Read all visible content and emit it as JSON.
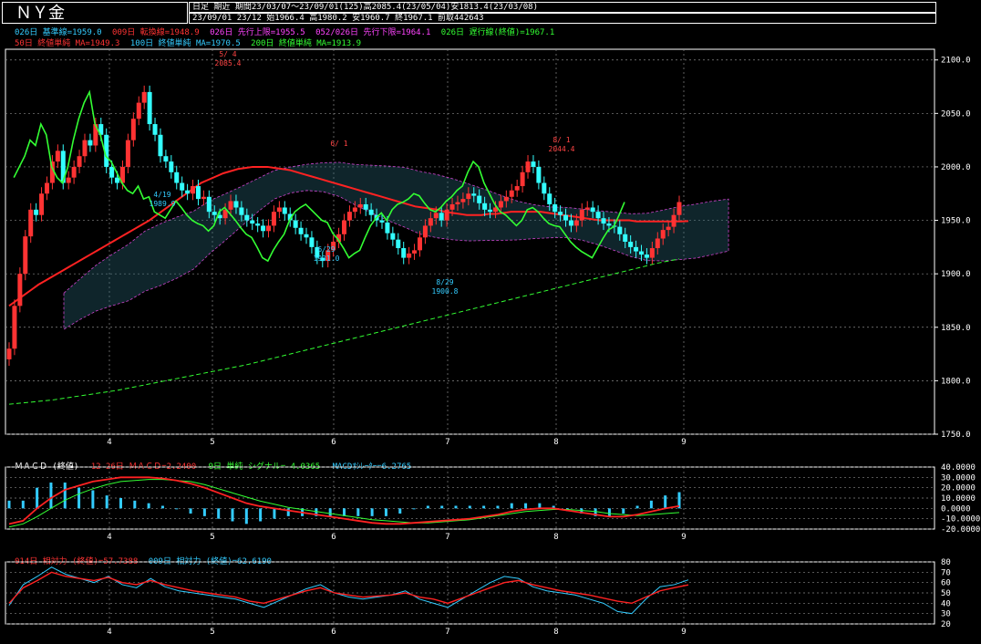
{
  "header": {
    "title": "ＮＹ金",
    "line1": "日足 期近 期間23/03/07～23/09/01(125)高2085.4(23/05/04)安1813.4(23/03/08)",
    "line2": "23/09/01 23/12 始1966.4 高1980.2 安1960.7 終1967.1 前取442643"
  },
  "legend": {
    "row1": [
      {
        "text": "026日 基準線=1959.0",
        "color": "#33ccff"
      },
      {
        "text": "009日 転換線=1948.9",
        "color": "#ff3333"
      },
      {
        "text": "026日 先行上限=1955.5",
        "color": "#ff44ff"
      },
      {
        "text": "052/026日 先行下限=1964.1",
        "color": "#ff44ff"
      },
      {
        "text": "026日 遅行線(終値)=1967.1",
        "color": "#33ff33"
      }
    ],
    "row2": [
      {
        "text": "50日 終値単純 MA=1949.3",
        "color": "#ff3333"
      },
      {
        "text": "100日 終値単純 MA=1970.5",
        "color": "#33ccff"
      },
      {
        "text": "200日 終値単純 MA=1913.9",
        "color": "#33ff33"
      }
    ]
  },
  "macd_legend": [
    {
      "text": "ＭＡＣＤ (終値)",
      "color": "#ffffff"
    },
    {
      "text": "12-26日 ＭＡＣＤ=2.2400",
      "color": "#ff3333"
    },
    {
      "text": "9日 単純 シグナル=-4.0365",
      "color": "#33ff33"
    },
    {
      "text": "MACDｵｼﾚｰﾀｰ=6.2765",
      "color": "#33ccff"
    }
  ],
  "rsi_legend": [
    {
      "text": "014日 相対力 (終値)=57.7388",
      "color": "#ff3333"
    },
    {
      "text": "009日 相対力 (終値)=62.6190",
      "color": "#33ccff"
    }
  ],
  "chart_data": [
    {
      "type": "candlestick",
      "title": "ＮＹ金",
      "x_ticks": [
        "4",
        "5",
        "6",
        "7",
        "8",
        "9"
      ],
      "y_ticks": [
        "2100.0",
        "2050.0",
        "2000.0",
        "1950.0",
        "1900.0",
        "1850.0",
        "1800.0",
        "1750.0"
      ],
      "ylim": [
        1750,
        2110
      ],
      "annotations": [
        {
          "date": "5/ 4",
          "value": "2085.4"
        },
        {
          "date": "4/19",
          "value": "1989.9"
        },
        {
          "date": "6/ 1",
          "value": ""
        },
        {
          "date": "6/29",
          "value": "1931.0"
        },
        {
          "date": "8/ 1",
          "value": "2044.4"
        },
        {
          "date": "8/29",
          "value": "1900.8"
        }
      ],
      "close": [
        1830,
        1870,
        1900,
        1935,
        1960,
        1955,
        1975,
        1985,
        2005,
        2015,
        1985,
        1990,
        2000,
        2010,
        2025,
        2020,
        2040,
        2030,
        2000,
        1990,
        1985,
        2000,
        2025,
        2045,
        2060,
        2070,
        2040,
        2030,
        2010,
        2005,
        1995,
        1985,
        1978,
        1975,
        1982,
        1970,
        1972,
        1958,
        1955,
        1952,
        1960,
        1968,
        1962,
        1955,
        1950,
        1947,
        1945,
        1940,
        1945,
        1958,
        1962,
        1956,
        1950,
        1943,
        1937,
        1934,
        1925,
        1915,
        1912,
        1922,
        1930,
        1937,
        1950,
        1958,
        1962,
        1965,
        1960,
        1955,
        1950,
        1948,
        1938,
        1932,
        1924,
        1915,
        1919,
        1922,
        1934,
        1945,
        1952,
        1957,
        1950,
        1960,
        1965,
        1967,
        1970,
        1975,
        1973,
        1966,
        1960,
        1958,
        1962,
        1968,
        1972,
        1978,
        1982,
        1995,
        2005,
        2000,
        1985,
        1975,
        1965,
        1958,
        1955,
        1950,
        1945,
        1950,
        1960,
        1962,
        1958,
        1952,
        1947,
        1945,
        1944,
        1937,
        1930,
        1925,
        1921,
        1918,
        1915,
        1924,
        1933,
        1941,
        1944,
        1955,
        1967.1
      ],
      "ma50": [
        1870,
        1875,
        1880,
        1885,
        1890,
        1894,
        1898,
        1902,
        1906,
        1910,
        1914,
        1918,
        1922,
        1926,
        1930,
        1934,
        1938,
        1942,
        1946,
        1950,
        1955,
        1960,
        1965,
        1970,
        1975,
        1980,
        1985,
        1988,
        1991,
        1994,
        1996,
        1998,
        1999,
        2000,
        2000,
        2000,
        1999,
        1998,
        1997,
        1995,
        1993,
        1991,
        1989,
        1987,
        1985,
        1983,
        1981,
        1979,
        1977,
        1975,
        1973,
        1971,
        1969,
        1967,
        1965,
        1963,
        1962,
        1961,
        1960,
        1958,
        1957,
        1956,
        1955,
        1955,
        1955,
        1956,
        1956,
        1957,
        1958,
        1958,
        1958,
        1958,
        1958,
        1957,
        1956,
        1955,
        1954,
        1953,
        1952,
        1951,
        1950,
        1950,
        1950,
        1950,
        1950,
        1949,
        1949,
        1949,
        1949,
        1949,
        1949,
        1949,
        1949.3
      ],
      "ma200": [
        1778,
        1780,
        1782,
        1785,
        1788,
        1791,
        1795,
        1799,
        1803,
        1807,
        1811,
        1815,
        1820,
        1825,
        1830,
        1835,
        1840,
        1845,
        1850,
        1855,
        1860,
        1865,
        1870,
        1875,
        1880,
        1885,
        1890,
        1895,
        1900,
        1905,
        1910,
        1913.9
      ]
    },
    {
      "type": "line",
      "title": "ＭＡＣＤ (終値)",
      "y_ticks": [
        "40.0000",
        "30.0000",
        "20.0000",
        "10.0000",
        "0.0000",
        "-10.0000",
        "-20.0000"
      ],
      "ylim": [
        -20,
        40
      ],
      "series": [
        {
          "name": "12-26日 ＭＡＣＤ",
          "values": [
            -15,
            -12,
            0,
            10,
            18,
            22,
            26,
            28,
            30,
            30,
            30,
            29,
            27,
            24,
            20,
            15,
            10,
            5,
            2,
            0,
            -2,
            -4,
            -6,
            -8,
            -10,
            -12,
            -14,
            -15,
            -15,
            -14,
            -13,
            -12,
            -11,
            -10,
            -8,
            -6,
            -3,
            -1,
            0,
            0,
            -2,
            -4,
            -6,
            -8,
            -8,
            -6,
            -3,
            0,
            2.24
          ]
        },
        {
          "name": "9日 単純 シグナル",
          "values": [
            -18,
            -15,
            -8,
            0,
            8,
            14,
            19,
            23,
            26,
            27,
            28,
            28,
            27,
            26,
            23,
            19,
            15,
            11,
            7,
            4,
            1,
            -1,
            -3,
            -5,
            -7,
            -9,
            -11,
            -12,
            -13,
            -14,
            -14,
            -13,
            -12,
            -11,
            -9,
            -7,
            -5,
            -3,
            -2,
            -1,
            -1,
            -2,
            -3,
            -5,
            -6,
            -7,
            -6,
            -5,
            -4.0365
          ]
        }
      ]
    },
    {
      "type": "line",
      "title": "相対力",
      "y_ticks": [
        "80",
        "70",
        "60",
        "50",
        "40",
        "30",
        "20"
      ],
      "ylim": [
        20,
        80
      ],
      "series": [
        {
          "name": "014日 相対力 (終値)",
          "values": [
            40,
            55,
            62,
            70,
            66,
            64,
            62,
            65,
            60,
            58,
            62,
            58,
            55,
            52,
            50,
            48,
            46,
            42,
            40,
            44,
            48,
            52,
            55,
            50,
            48,
            46,
            47,
            48,
            50,
            46,
            44,
            40,
            45,
            50,
            55,
            60,
            62,
            58,
            55,
            52,
            50,
            48,
            45,
            42,
            40,
            46,
            52,
            55,
            57.7388
          ]
        },
        {
          "name": "009日 相対力 (終値)",
          "values": [
            38,
            58,
            66,
            75,
            68,
            64,
            60,
            66,
            58,
            55,
            64,
            56,
            52,
            50,
            48,
            46,
            44,
            40,
            36,
            42,
            48,
            54,
            58,
            50,
            46,
            44,
            46,
            48,
            52,
            44,
            40,
            36,
            44,
            52,
            60,
            66,
            64,
            56,
            52,
            50,
            48,
            44,
            40,
            32,
            30,
            44,
            56,
            58,
            62.619
          ]
        }
      ]
    }
  ]
}
